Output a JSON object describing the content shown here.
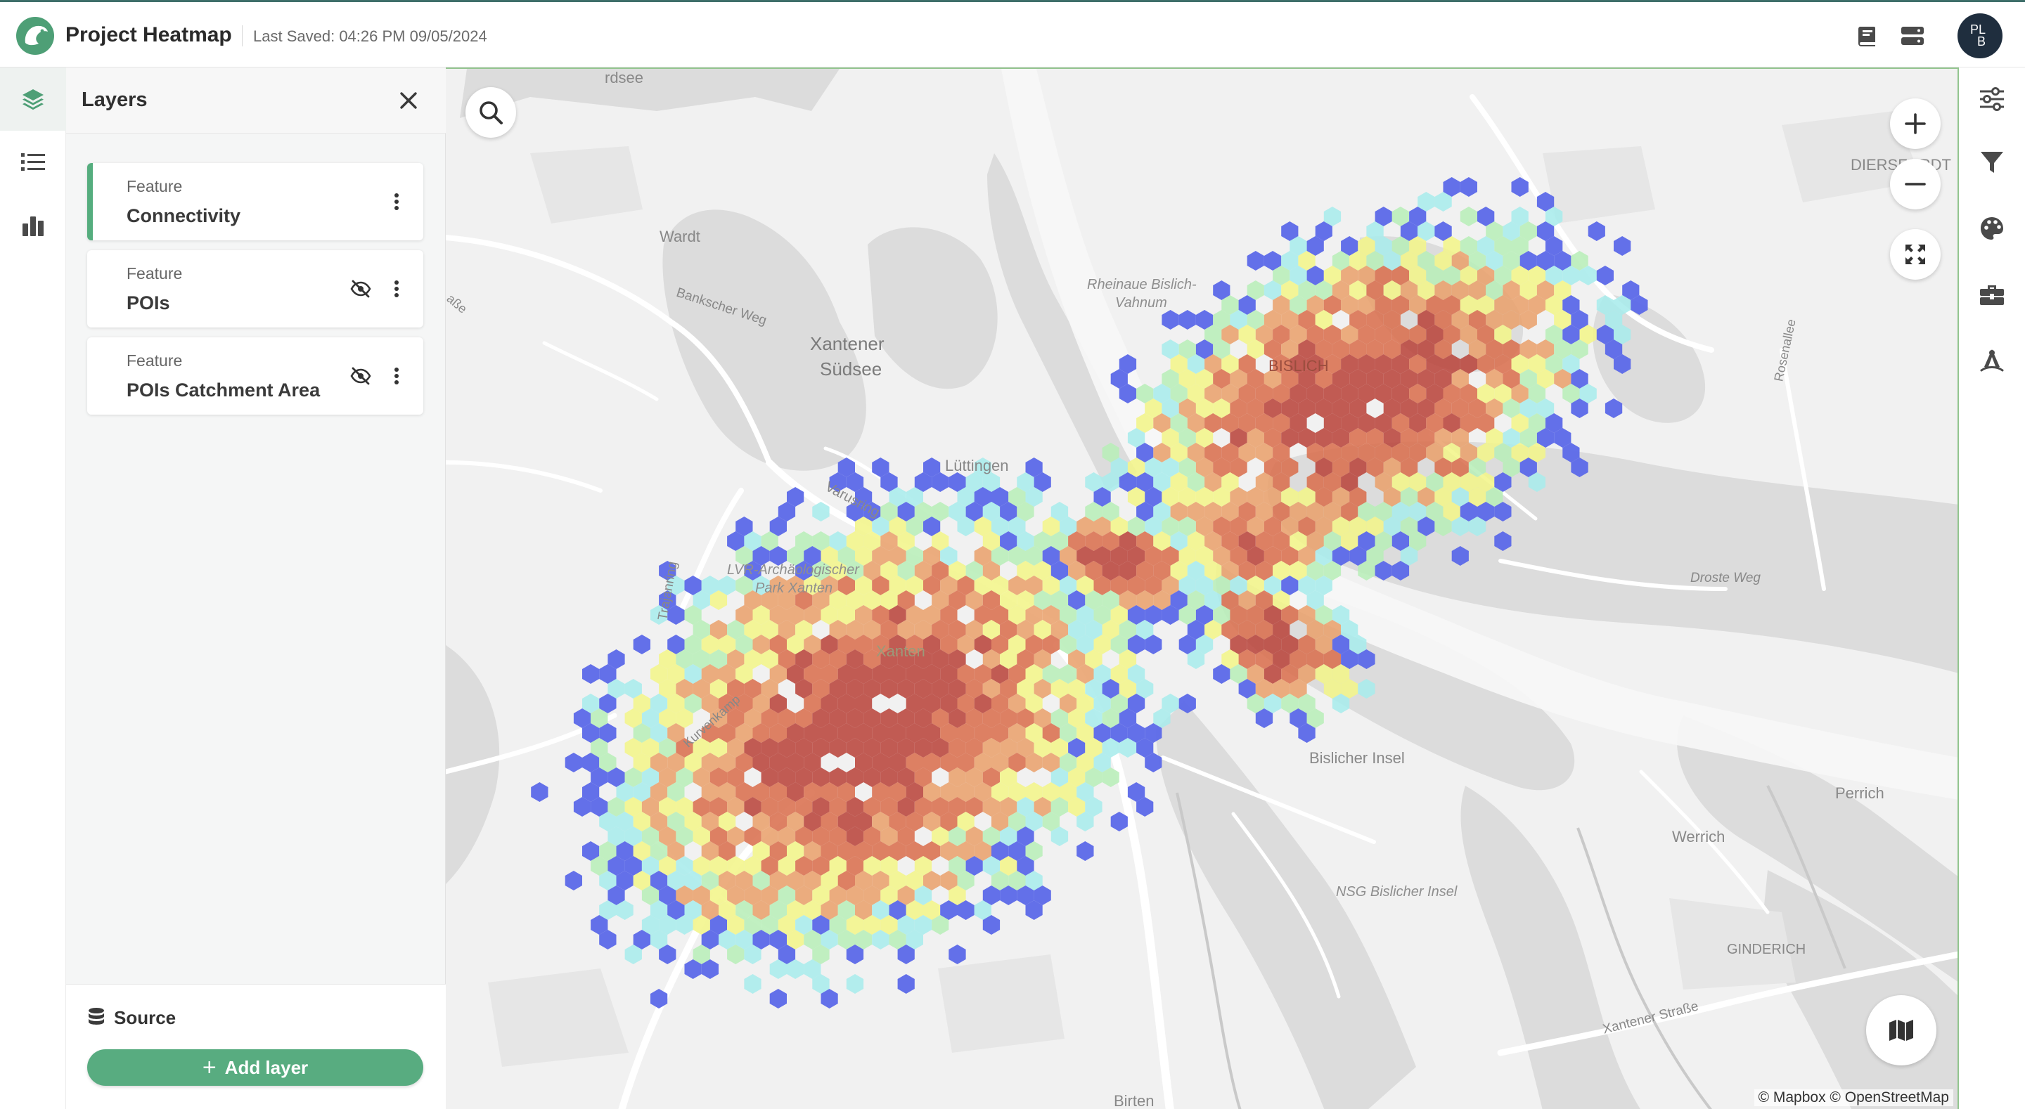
{
  "header": {
    "app_title": "Project Heatmap",
    "saved_label": "Last Saved:",
    "saved_time": "04:26 PM 09/05/2024",
    "avatar_initials_top": "PL",
    "avatar_initials_bottom": "B",
    "icons": [
      "book-icon",
      "layout-toggle-icon"
    ]
  },
  "rail": {
    "items": [
      {
        "name": "layers-icon",
        "active": true
      },
      {
        "name": "list-icon",
        "active": false
      },
      {
        "name": "chart-icon",
        "active": false
      }
    ]
  },
  "layers_panel": {
    "title": "Layers",
    "layers": [
      {
        "type": "Feature",
        "name": "Connectivity",
        "hidden": false,
        "selected": true
      },
      {
        "type": "Feature",
        "name": "POIs",
        "hidden": true,
        "selected": false
      },
      {
        "type": "Feature",
        "name": "POIs Catchment Area",
        "hidden": true,
        "selected": false
      }
    ],
    "source_label": "Source",
    "add_layer_label": "Add layer"
  },
  "map": {
    "attribution": "© Mapbox © OpenStreetMap",
    "places": {
      "nordsee": "rdsee",
      "wardt": "Wardt",
      "bankscher_weg": "Bankscher Weg",
      "xantener_sudsee_1": "Xantener",
      "xantener_sudsee_2": "Südsee",
      "rheinaue_1": "Rheinaue Bislich-",
      "rheinaue_2": "Vahnum",
      "bislich": "BISLICH",
      "diersfordt": "DIERSFORDT",
      "rosenallee": "Rosenallee",
      "luttingen": "Lüttingen",
      "varusring": "Varusring",
      "trajanring": "Trajanring",
      "lvr_1": "LVR-Archäologischer",
      "lvr_2": "Park Xanten",
      "xanten": "Xanten",
      "droste_weg": "Droste Weg",
      "bislicher_insel": "Bislicher Insel",
      "perrich": "Perrich",
      "werrich": "Werrich",
      "nsg": "NSG Bislicher Insel",
      "ginderich": "GINDERICH",
      "xantener_strasse": "Xantener Straße",
      "kurvenkamp": "Kurvenkamp",
      "hee": "aße",
      "birten": "Birten"
    },
    "heat_palette": [
      "#5b68e8",
      "#a9ecec",
      "#b8eeb8",
      "#f2f58a",
      "#e9a26d",
      "#d9704f",
      "#b9453c"
    ],
    "controls": [
      "search-icon",
      "zoom-in-icon",
      "zoom-out-icon",
      "fullscreen-icon",
      "basemap-icon"
    ]
  },
  "right_toolbar": {
    "items": [
      "sliders-icon",
      "filter-icon",
      "palette-icon",
      "toolbox-icon",
      "draw-icon"
    ]
  }
}
